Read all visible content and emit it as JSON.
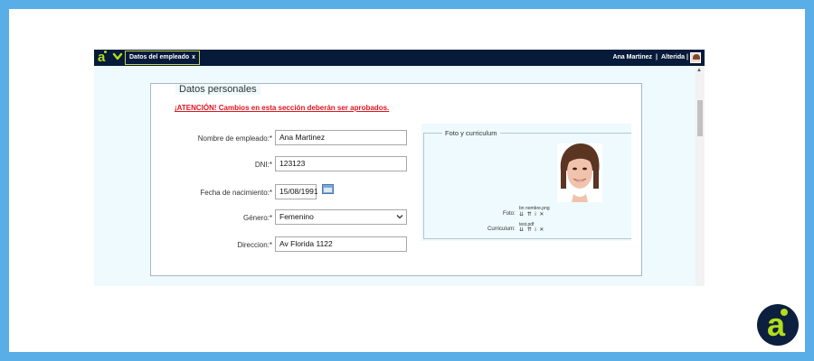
{
  "topbar": {
    "tab_label": "Datos del empleado",
    "tab_close": "x",
    "user_name": "Ana Martinez",
    "user_separator": "|",
    "company": "Alterida",
    "company_separator": "|"
  },
  "form": {
    "section_title": "Datos personales",
    "attention": "¡ATENCIÓN! Cambios en esta sección deberán ser aprobados.",
    "fields": [
      {
        "label": "Nombre de empleado:*",
        "value": "Ana Martinez"
      },
      {
        "label": "DNI:*",
        "value": "123123"
      },
      {
        "label": "Fecha de nacimiento:*",
        "value": "15/08/1991"
      },
      {
        "label": "Género:*",
        "value": "Femenino"
      },
      {
        "label": "Direccion:*",
        "value": "Av Florida 1122"
      }
    ]
  },
  "photo_section": {
    "title": "Foto y curriculum",
    "foto_label": "Foto:",
    "foto_filename": "bn nombre.png",
    "cv_label": "Curriculum:",
    "cv_filename": "test.pdf",
    "actions": "⇊ ⇈ i ✕"
  },
  "colors": {
    "topbar": "#061a3a",
    "accent_green": "#b4dc1c",
    "alert_red": "#e0141e",
    "frame_blue": "#5aaee8"
  },
  "icons": {
    "brand_logo": "alterida-logo-icon",
    "menu_chevron": "chevron-down-icon",
    "calendar": "calendar-icon"
  }
}
